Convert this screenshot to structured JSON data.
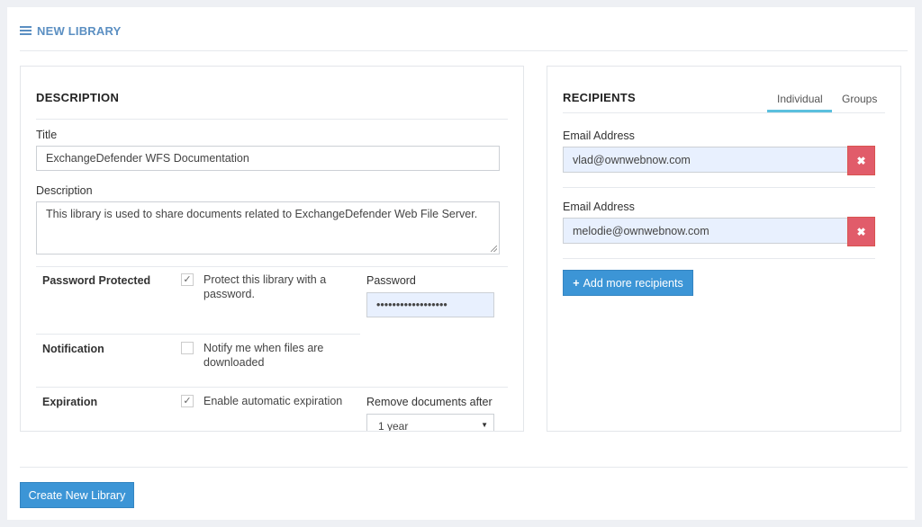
{
  "header": {
    "icon": "list-icon",
    "title": "NEW LIBRARY"
  },
  "description_panel": {
    "title": "DESCRIPTION",
    "title_label": "Title",
    "title_value": "ExchangeDefender WFS Documentation",
    "description_label": "Description",
    "description_value": "This library is used to share documents related to ExchangeDefender Web File Server.",
    "options": {
      "password": {
        "label": "Password Protected",
        "checked": true,
        "checkbox_text": "Protect this library with a password.",
        "field_label": "Password",
        "field_value": "••••••••••••••••••"
      },
      "notification": {
        "label": "Notification",
        "checked": false,
        "checkbox_text": "Notify me when files are downloaded"
      },
      "expiration": {
        "label": "Expiration",
        "checked": true,
        "checkbox_text": "Enable automatic expiration",
        "field_label": "Remove documents after",
        "selected": "1 year"
      }
    }
  },
  "recipients_panel": {
    "title": "RECIPIENTS",
    "tabs": [
      {
        "label": "Individual",
        "active": true
      },
      {
        "label": "Groups",
        "active": false
      }
    ],
    "recipients": [
      {
        "label": "Email Address",
        "value": "vlad@ownwebnow.com"
      },
      {
        "label": "Email Address",
        "value": "melodie@ownwebnow.com"
      }
    ],
    "add_button": "Add more recipients"
  },
  "footer": {
    "create_button": "Create New Library"
  },
  "colors": {
    "accent": "#3c95d6",
    "header": "#5b8fc2",
    "danger": "#e15c6a",
    "tab_active": "#5bc0de",
    "filled_input": "#e8f0fe"
  }
}
